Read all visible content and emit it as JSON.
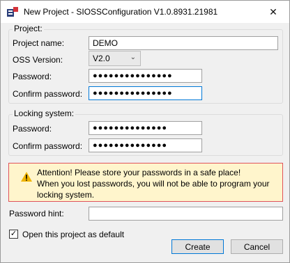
{
  "window": {
    "title": "New Project - SIOSSConfiguration V1.0.8931.21981",
    "close_glyph": "✕"
  },
  "project": {
    "legend": "Project:",
    "name_label": "Project name:",
    "name_value": "DEMO",
    "oss_label": "OSS Version:",
    "oss_value": "V2.0",
    "password_label": "Password:",
    "password_value": "●●●●●●●●●●●●●●●",
    "confirm_label": "Confirm password:",
    "confirm_value": "●●●●●●●●●●●●●●●"
  },
  "locking": {
    "legend": "Locking system:",
    "password_label": "Password:",
    "password_value": "●●●●●●●●●●●●●●",
    "confirm_label": "Confirm password:",
    "confirm_value": "●●●●●●●●●●●●●●"
  },
  "warning": {
    "line1": "Attention! Please store your passwords in a safe place!",
    "line2": "When you lost passwords, you will not be able to program your locking system."
  },
  "hint": {
    "label": "Password hint:",
    "value": ""
  },
  "default_checkbox": {
    "label": "Open this project as default",
    "checked": true,
    "check_glyph": "✓"
  },
  "buttons": {
    "create": "Create",
    "cancel": "Cancel"
  },
  "colors": {
    "focus": "#0078d7",
    "warning_bg": "#fff5cc",
    "warning_border": "#e0525a",
    "warning_icon": "#f0b400"
  }
}
